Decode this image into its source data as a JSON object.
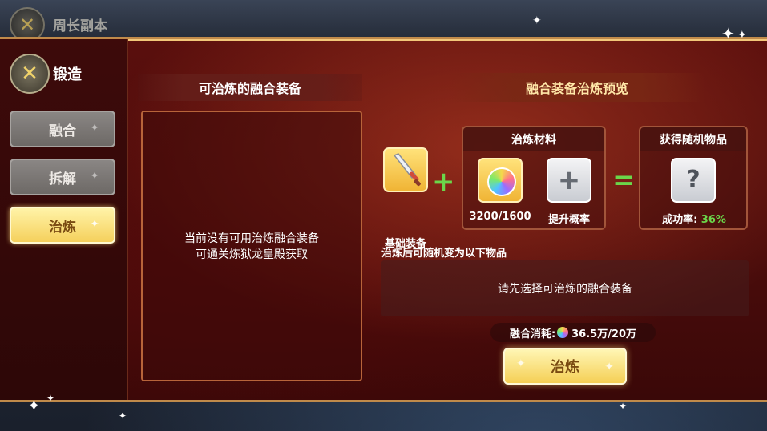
{
  "top_bar": {
    "title": "周长副本",
    "badge_icon": "crossed-swords-icon"
  },
  "sidebar": {
    "title": "锻造",
    "tabs": [
      {
        "label": "融合",
        "active": false
      },
      {
        "label": "拆解",
        "active": false
      },
      {
        "label": "治炼",
        "active": true
      }
    ]
  },
  "list_panel": {
    "header": "可治炼的融合装备",
    "empty_line1": "当前没有可用治炼融合装备",
    "empty_line2": "可通关炼狱龙皇殿获取"
  },
  "preview": {
    "title": "融合装备治炼预览",
    "base_label": "基础装备",
    "base_icon": "sword-icon",
    "materials_header": "治炼材料",
    "material_count": "3200/1600",
    "material_icon": "rainbow-orb-icon",
    "boost_label": "提升概率",
    "boost_icon": "plus-icon",
    "reward_header": "获得随机物品",
    "reward_icon": "question-icon",
    "success_label": "成功率:",
    "success_rate": "36%",
    "random_label": "治炼后可随机变为以下物品",
    "random_hint": "请先选择可治炼的融合装备",
    "cost_label": "融合消耗:",
    "cost_value": "36.5万/20万",
    "action_label": "治炼"
  },
  "colors": {
    "accent_green": "#6bd64a",
    "button_gold": "#f5cf55",
    "panel_red": "#5a0f0d"
  }
}
